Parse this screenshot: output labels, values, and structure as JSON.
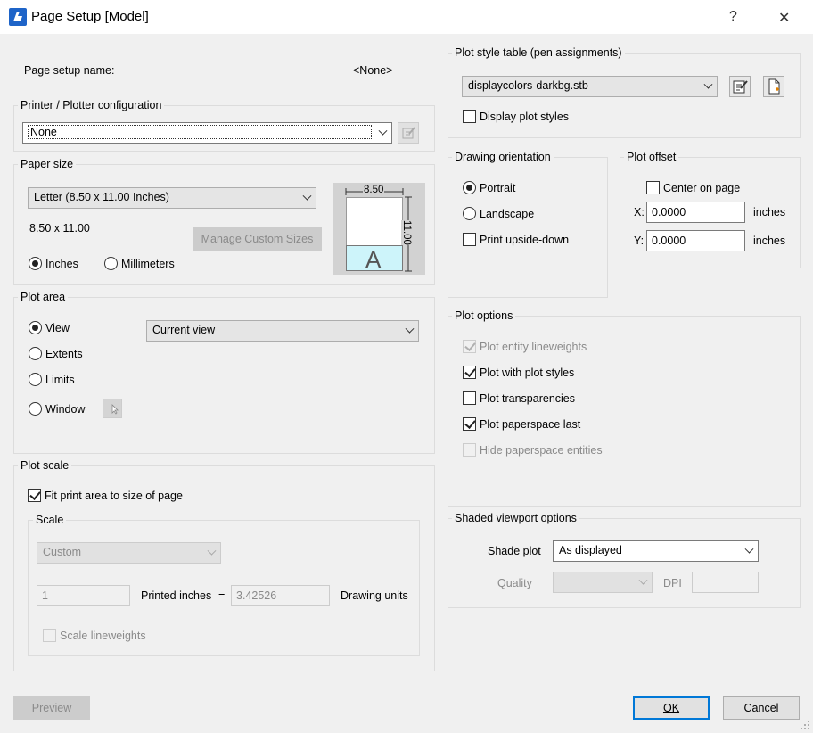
{
  "window": {
    "title": "Page Setup [Model]",
    "help": "?",
    "close": "✕"
  },
  "page_setup": {
    "label": "Page setup name:",
    "value": "<None>"
  },
  "printer": {
    "group_label": "Printer / Plotter configuration",
    "selected": "None"
  },
  "paper": {
    "group_label": "Paper size",
    "selected": "Letter (8.50 x 11.00 Inches)",
    "dimensions": "8.50 x 11.00",
    "manage_button": "Manage Custom Sizes",
    "inches_label": "Inches",
    "millimeters_label": "Millimeters",
    "preview_width": "8.50",
    "preview_height": "11.00",
    "preview_letter": "A"
  },
  "plot_area": {
    "group_label": "Plot area",
    "view_label": "View",
    "extents_label": "Extents",
    "limits_label": "Limits",
    "window_label": "Window",
    "selected": "Current view"
  },
  "plot_scale": {
    "group_label": "Plot scale",
    "fit_label": "Fit print area to size of page",
    "scale_group_label": "Scale",
    "scale_selected": "Custom",
    "printed_value": "1",
    "printed_label": "Printed inches",
    "equals": "=",
    "drawing_value": "3.42526",
    "drawing_label": "Drawing units",
    "lineweights_label": "Scale lineweights"
  },
  "plot_style": {
    "group_label": "Plot style table (pen assignments)",
    "selected": "displaycolors-darkbg.stb",
    "display_label": "Display plot styles"
  },
  "orientation": {
    "group_label": "Drawing orientation",
    "portrait_label": "Portrait",
    "landscape_label": "Landscape",
    "upside_label": "Print upside-down"
  },
  "offset": {
    "group_label": "Plot offset",
    "center_label": "Center on page",
    "x_label": "X:",
    "x_value": "0.0000",
    "x_unit": "inches",
    "y_label": "Y:",
    "y_value": "0.0000",
    "y_unit": "inches"
  },
  "plot_options": {
    "group_label": "Plot options",
    "lineweights_label": "Plot entity lineweights",
    "styles_label": "Plot with plot styles",
    "transparencies_label": "Plot transparencies",
    "paperspace_last_label": "Plot paperspace last",
    "hide_label": "Hide paperspace entities"
  },
  "shaded": {
    "group_label": "Shaded viewport options",
    "shade_label": "Shade plot",
    "shade_selected": "As displayed",
    "quality_label": "Quality",
    "quality_selected": "",
    "dpi_label": "DPI",
    "dpi_value": ""
  },
  "footer": {
    "preview": "Preview",
    "ok": "OK",
    "cancel": "Cancel"
  },
  "colors": {
    "accent": "#0078d7",
    "paper_sheet": "#ffffff",
    "paper_preview_band": "#cdf4fa"
  }
}
